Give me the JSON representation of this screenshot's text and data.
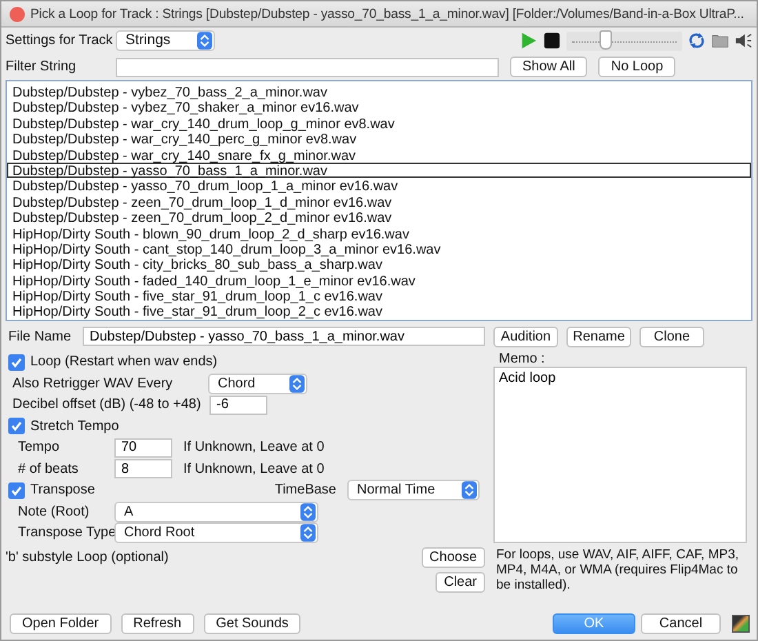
{
  "window": {
    "title": "Pick a Loop for Track : Strings   [Dubstep/Dubstep - yasso_70_bass_1_a_minor.wav]   [Folder:/Volumes/Band-in-a-Box UltraP..."
  },
  "settings": {
    "label": "Settings for Track",
    "value": "Strings"
  },
  "player": {
    "level": 0.3
  },
  "filter": {
    "label": "Filter String",
    "buttons": [
      "Show All",
      "No Loop"
    ]
  },
  "files": [
    {
      "name": "Dubstep/Dubstep - vybez_70_bass_2_a_minor.wav",
      "selected": false
    },
    {
      "name": "Dubstep/Dubstep - vybez_70_shaker_a_minor ev16.wav",
      "selected": false
    },
    {
      "name": "Dubstep/Dubstep - war_cry_140_drum_loop_g_minor ev8.wav",
      "selected": false
    },
    {
      "name": "Dubstep/Dubstep - war_cry_140_perc_g_minor ev8.wav",
      "selected": false
    },
    {
      "name": "Dubstep/Dubstep - war_cry_140_snare_fx_g_minor.wav",
      "selected": false
    },
    {
      "name": "Dubstep/Dubstep - yasso_70_bass_1_a_minor.wav",
      "selected": true
    },
    {
      "name": "Dubstep/Dubstep - yasso_70_drum_loop_1_a_minor ev16.wav",
      "selected": false
    },
    {
      "name": "Dubstep/Dubstep - zeen_70_drum_loop_1_d_minor ev16.wav",
      "selected": false
    },
    {
      "name": "Dubstep/Dubstep - zeen_70_drum_loop_2_d_minor ev16.wav",
      "selected": false
    },
    {
      "name": "HipHop/Dirty South - blown_90_drum_loop_2_d_sharp ev16.wav",
      "selected": false
    },
    {
      "name": "HipHop/Dirty South - cant_stop_140_drum_loop_3_a_minor ev16.wav",
      "selected": false
    },
    {
      "name": "HipHop/Dirty South - city_bricks_80_sub_bass_a_sharp.wav",
      "selected": false
    },
    {
      "name": "HipHop/Dirty South - faded_140_drum_loop_1_e_minor ev16.wav",
      "selected": false
    },
    {
      "name": "HipHop/Dirty South - five_star_91_drum_loop_1_c ev16.wav",
      "selected": false
    },
    {
      "name": "HipHop/Dirty South - five_star_91_drum_loop_2_c ev16.wav",
      "selected": false
    }
  ],
  "file_name": {
    "label": "File Name",
    "value": "Dubstep/Dubstep - yasso_70_bass_1_a_minor.wav",
    "buttons": [
      "Audition",
      "Rename",
      "Clone"
    ]
  },
  "loop": {
    "label": "Loop (Restart when wav ends)",
    "checked": true
  },
  "retrigger": {
    "label": "Also Retrigger WAV Every",
    "value": "Chord"
  },
  "decibel": {
    "label": "Decibel offset (dB) (-48 to +48)",
    "value": "-6"
  },
  "stretch": {
    "label": "Stretch Tempo",
    "checked": true
  },
  "tempo": {
    "label": "Tempo",
    "value": "70",
    "hint": "If Unknown, Leave at 0"
  },
  "beats": {
    "label": "# of beats",
    "value": "8",
    "hint": "If Unknown, Leave at 0"
  },
  "transpose": {
    "label": "Transpose",
    "checked": true
  },
  "timebase": {
    "label": "TimeBase",
    "value": "Normal Time"
  },
  "note": {
    "label": "Note (Root)",
    "value": "A"
  },
  "transpose_type": {
    "label": "Transpose Type",
    "value": "Chord Root"
  },
  "substyle": {
    "label": "'b' substyle Loop (optional)",
    "buttons": [
      "Choose",
      "Clear"
    ]
  },
  "memo": {
    "label": "Memo :",
    "value": "Acid loop"
  },
  "note_text": "For loops, use WAV, AIF, AIFF, CAF, MP3, MP4, M4A, or WMA (requires Flip4Mac to be installed).",
  "footer": {
    "left_buttons": [
      "Open Folder",
      "Refresh",
      "Get Sounds"
    ],
    "ok": "OK",
    "cancel": "Cancel"
  }
}
